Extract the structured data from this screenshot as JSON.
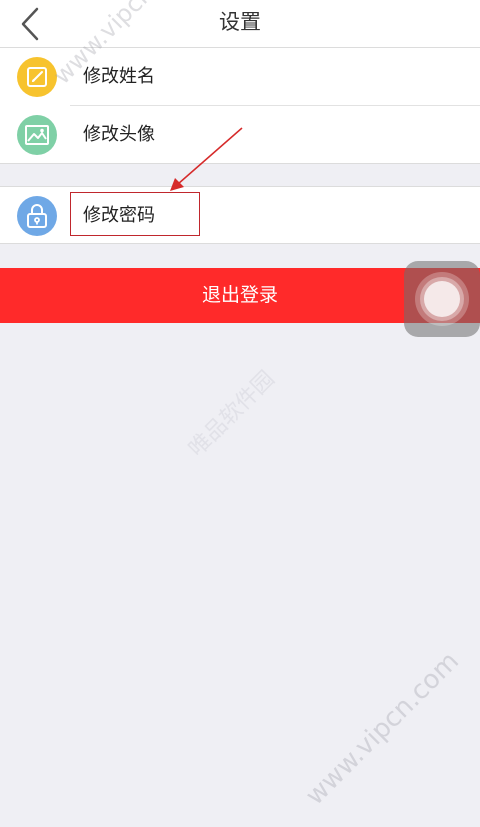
{
  "nav": {
    "title": "设置"
  },
  "menu_group_1": [
    {
      "label": "修改姓名",
      "icon": "edit-icon",
      "color": "#f7c32e"
    },
    {
      "label": "修改头像",
      "icon": "image-icon",
      "color": "#7fd0a6"
    }
  ],
  "menu_group_2": [
    {
      "label": "修改密码",
      "icon": "lock-icon",
      "color": "#6fa8e6"
    }
  ],
  "logout": {
    "label": "退出登录",
    "color": "#ff2a2a"
  },
  "watermark": {
    "text_1": "www.vipcn.com",
    "text_2": "www.vipcn.com",
    "text_3": "唯品软件园"
  }
}
